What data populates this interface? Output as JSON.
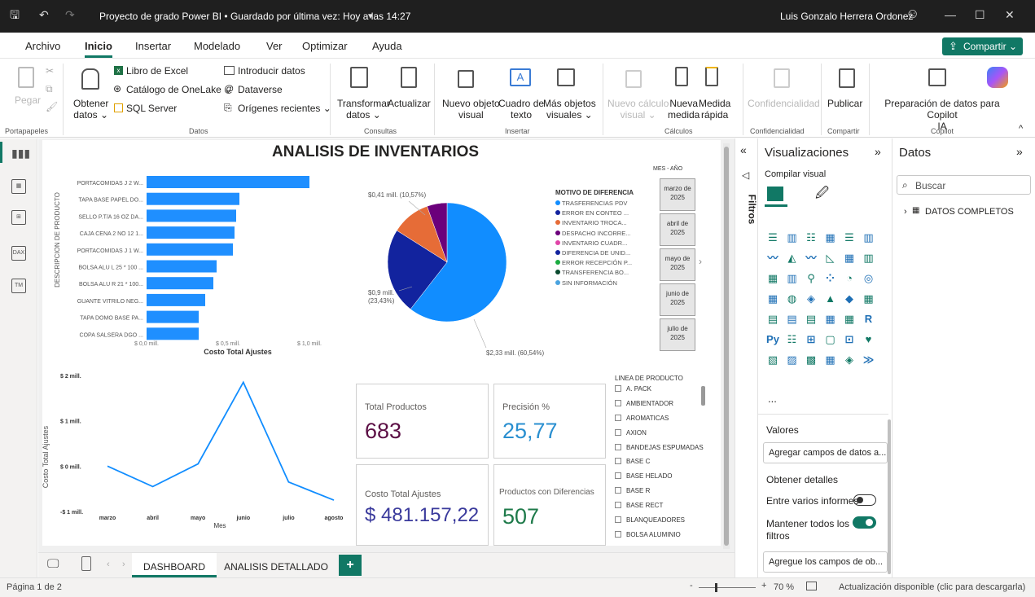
{
  "titlebar": {
    "title": "Proyecto de grado Power BI • Guardado por última vez: Hoy a las 14:27",
    "user": "Luis Gonzalo Herrera Ordonez"
  },
  "menu": {
    "items": [
      "Archivo",
      "Inicio",
      "Insertar",
      "Modelado",
      "Ver",
      "Optimizar",
      "Ayuda"
    ],
    "share": "Compartir"
  },
  "ribbon": {
    "pegar": "Pegar",
    "portapapeles": "Portapapeles",
    "obtener_datos": [
      "Obtener",
      "datos ⌄"
    ],
    "libro_excel": "Libro de Excel",
    "onelake": "Catálogo de OneLake ⌄",
    "sql": "SQL Server",
    "introducir": "Introducir datos",
    "dataverse": "Dataverse",
    "origenes": "Orígenes recientes ⌄",
    "datos_grp": "Datos",
    "transformar": [
      "Transformar",
      "datos ⌄"
    ],
    "actualizar": "Actualizar",
    "consultas": "Consultas",
    "nuevo_objeto": [
      "Nuevo objeto",
      "visual"
    ],
    "cuadro_texto": [
      "Cuadro de",
      "texto"
    ],
    "mas_objetos": [
      "Más objetos",
      "visuales ⌄"
    ],
    "insertar_grp": "Insertar",
    "nuevo_calculo": [
      "Nuevo cálculo",
      "visual ⌄"
    ],
    "nueva_medida": [
      "Nueva",
      "medida"
    ],
    "medida_rapida": [
      "Medida",
      "rápida"
    ],
    "calculos": "Cálculos",
    "confidencialidad": "Confidencialidad",
    "confidencialidad_grp": "Confidencialidad",
    "publicar": "Publicar",
    "compartir_grp": "Compartir",
    "copilot_prep": [
      "Preparación de datos para Copilot",
      "IA"
    ],
    "copilot_grp": "Copilot"
  },
  "report": {
    "title": "ANALISIS DE INVENTARIOS",
    "bar_chart": {
      "ylabel": "DESCRIPCION DE PRODUCTO",
      "xlabel": "Costo Total Ajustes",
      "ticks": [
        "$ 0,0 mill.",
        "$ 0,5 mill.",
        "$ 1,0 mill."
      ]
    },
    "pie_chart": {
      "legend_title": "MOTIVO DE DIFERENCIA",
      "labels": [
        "$0,41 mill. (10,57%)",
        "$0,9 mill.",
        "(23,43%)",
        "$2,33 mill. (60,54%)"
      ]
    },
    "slicer_mes": {
      "title": "MES - AÑO",
      "items": [
        "marzo de 2025",
        "abril de 2025",
        "mayo de 2025",
        "junio de 2025",
        "julio de 2025"
      ]
    },
    "line_chart": {
      "ylabel": "Costo Total Ajustes",
      "xlabel": "Mes",
      "yticks": [
        "$ 2 mill.",
        "$ 1 mill.",
        "$ 0 mill.",
        "-$ 1 mill."
      ]
    },
    "cards": [
      {
        "label": "Total Productos",
        "value": "683",
        "color": "#5c0f45"
      },
      {
        "label": "Precisión %",
        "value": "25,77",
        "color": "#2a8fd0"
      },
      {
        "label": "Costo Total Ajustes",
        "value": "$ 481.157,22",
        "color": "#3a3a9c"
      },
      {
        "label": "Productos con Diferencias",
        "value": "507",
        "color": "#1e7a4a"
      }
    ],
    "slicer_linea": {
      "title": "LINEA DE PRODUCTO",
      "items": [
        "A. PACK",
        "AMBIENTADOR",
        "AROMATICAS",
        "AXION",
        "BANDEJAS ESPUMADAS",
        "BASE C",
        "BASE HELADO",
        "BASE R",
        "BASE RECT",
        "BLANQUEADORES",
        "BOLSA ALUMINIO"
      ]
    }
  },
  "chart_data": [
    {
      "type": "bar",
      "orientation": "horizontal",
      "categories": [
        "PORTACOMIDAS J 2 W...",
        "TAPA BASE PAPEL DO...",
        "SELLO P.T/A 16 OZ DA...",
        "CAJA CENA 2 NO 12 1...",
        "PORTACOMIDAS J 1 W...",
        "BOLSA ALU L 25 * 100 ...",
        "BOLSA ALU R 21 * 100...",
        "GUANTE VITRILO NEG...",
        "TAPA DOMO BASE PA...",
        "COPA SALSERA DGO ..."
      ],
      "values": [
        1.0,
        0.57,
        0.55,
        0.54,
        0.53,
        0.43,
        0.41,
        0.36,
        0.32,
        0.32
      ],
      "xlabel": "Costo Total Ajustes",
      "ylabel": "DESCRIPCION DE PRODUCTO",
      "xlim": [
        0,
        1.2
      ],
      "unit": "mill.",
      "color": "#1f8fff"
    },
    {
      "type": "pie",
      "title": "MOTIVO DE DIFERENCIA",
      "categories": [
        "TRASFERENCIAS PDV",
        "ERROR EN CONTEO ...",
        "INVENTARIO TROCA...",
        "DESPACHO INCORRE...",
        "INVENTARIO CUADR...",
        "DIFERENCIA DE UNID...",
        "ERROR RECEPCIÓN P...",
        "TRANSFERENCIA BO...",
        "SIN INFORMACIÓN"
      ],
      "values": [
        60.54,
        23.43,
        10.57,
        5.46,
        0,
        0,
        0,
        0,
        0
      ],
      "colors": [
        "#118dff",
        "#12239e",
        "#e66c37",
        "#6b007b",
        "#e044a7",
        "#744ec2",
        "#d9b300",
        "#0a4a2e",
        "#4aa3df"
      ],
      "legend_colors": [
        "#118dff",
        "#12239e",
        "#e66c37",
        "#6b007b",
        "#e044a7",
        "#12239e",
        "#1aab40",
        "#0a4a2e",
        "#4aa3df"
      ]
    },
    {
      "type": "line",
      "categories": [
        "marzo",
        "abril",
        "mayo",
        "junio",
        "julio",
        "agosto"
      ],
      "values": [
        0.0,
        -0.45,
        0.05,
        1.85,
        -0.35,
        -0.75
      ],
      "xlabel": "Mes",
      "ylabel": "Costo Total Ajustes",
      "ylim": [
        -1,
        2
      ],
      "unit": "mill.",
      "color": "#118dff"
    }
  ],
  "viz_pane": {
    "title": "Visualizaciones",
    "build": "Compilar visual",
    "valores": "Valores",
    "valores_ph": "Agregar campos de datos a...",
    "detalles": "Obtener detalles",
    "entre_informes": "Entre varios informes",
    "mantener": "Mantener todos los filtros",
    "agregue": "Agregue los campos de ob...",
    "more": "..."
  },
  "filtros": "Filtros",
  "datos_pane": {
    "title": "Datos",
    "search_ph": "Buscar",
    "table": "DATOS COMPLETOS"
  },
  "tabs": [
    "DASHBOARD",
    "ANALISIS DETALLADO"
  ],
  "status": {
    "page": "Página 1 de 2",
    "zoom": "70 %",
    "update": "Actualización disponible (clic para descargarla)"
  }
}
